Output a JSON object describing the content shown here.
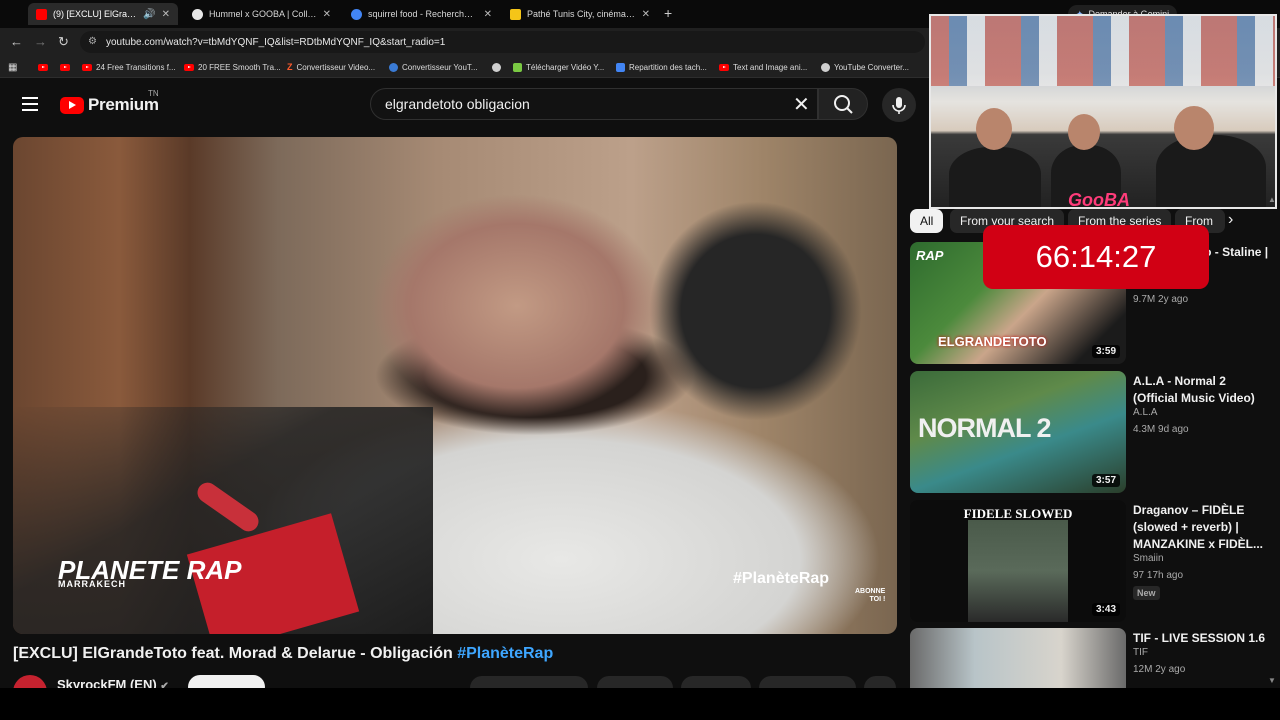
{
  "browser": {
    "tabs": [
      {
        "title": "(9) [EXCLU] ElGrandeToto fe",
        "active": true,
        "favicon_color": "#ff0000",
        "audio": true
      },
      {
        "title": "Hummel x GOOBA | Collection",
        "active": false,
        "favicon_color": "#ffffff"
      },
      {
        "title": "squirrel food - Recherche Goog",
        "active": false,
        "favicon_color": "#4285f4"
      },
      {
        "title": "Pathé Tunis City, cinéma à cebe",
        "active": false,
        "favicon_color": "#f5c518"
      }
    ],
    "new_tab": "+",
    "gemini_button": "Demander à Gemini",
    "url": "youtube.com/watch?v=tbMdYQNF_IQ&list=RDtbMdYQNF_IQ&start_radio=1",
    "bookmarks": [
      {
        "label": "",
        "icon": "youtube"
      },
      {
        "label": "",
        "icon": "youtube"
      },
      {
        "label": "24 Free Transitions f...",
        "icon": "youtube"
      },
      {
        "label": "20 FREE Smooth Tra...",
        "icon": "youtube"
      },
      {
        "label": "Convertisseur Video...",
        "icon": "z-icon"
      },
      {
        "label": "Convertisseur YouT...",
        "icon": "converter"
      },
      {
        "label": "",
        "icon": "globe"
      },
      {
        "label": "Télécharger Vidéo Y...",
        "icon": "download"
      },
      {
        "label": "Repartition des tach...",
        "icon": "docs"
      },
      {
        "label": "Text and Image ani...",
        "icon": "youtube"
      },
      {
        "label": "YouTube Converter...",
        "icon": "globe"
      }
    ]
  },
  "youtube": {
    "logo": "Premium",
    "region": "TN",
    "search_query": "elgrandetoto obligacion"
  },
  "player": {
    "overlay_hashtag": "#PlanèteRap",
    "overlay_subscribe_line1": "ABONNE",
    "overlay_subscribe_line2": "TOI !",
    "overlay_wordmark": "PLANETE RAP",
    "overlay_wordmark_sub": "MARRAKECH"
  },
  "video": {
    "title_main": "[EXCLU] ElGrandeToto feat. Morad & Delarue - Obligación ",
    "title_hashtag": "#PlanèteRap",
    "channel": "SkyrockFM (EN)"
  },
  "filters": [
    "All",
    "From your search",
    "From the series",
    "From"
  ],
  "recommendations": [
    {
      "title": "ElGrandeToto - Staline | Planète Rap",
      "channel": "",
      "meta": "9.7M  2y ago",
      "duration": "3:59",
      "thumb_colors": [
        "#2e6b2e",
        "#caa58a",
        "#1b1b1b"
      ],
      "thumb_text": "ELGRANDETOTO"
    },
    {
      "title": "A.L.A - Normal 2 (Official Music Video)",
      "channel": "A.L.A",
      "meta": "4.3M  9d ago",
      "duration": "3:57",
      "thumb_colors": [
        "#3b6b3a",
        "#3a8a8a",
        "#2a3e2a"
      ],
      "thumb_text": "NORMAL 2"
    },
    {
      "title": "Draganov – FIDÈLE (slowed + reverb) | MANZAKINE x FIDÈL...",
      "channel": "Smaiin",
      "meta": "97  17h ago",
      "duration": "3:43",
      "badge": "New",
      "thumb_colors": [
        "#0c0c0c",
        "#5a6a5a",
        "#2a2a2a"
      ],
      "thumb_text": "FIDELE SLOWED"
    },
    {
      "title": "TIF - LIVE SESSION 1.6",
      "channel": "TIF",
      "meta": "12M  2y ago",
      "duration": "",
      "thumb_colors": [
        "#b8c4c8",
        "#d8d4cc",
        "#6a6a6a"
      ],
      "thumb_text": ""
    }
  ],
  "overlay": {
    "timer": "66:14:27",
    "webcam_logo": "GooBA"
  }
}
